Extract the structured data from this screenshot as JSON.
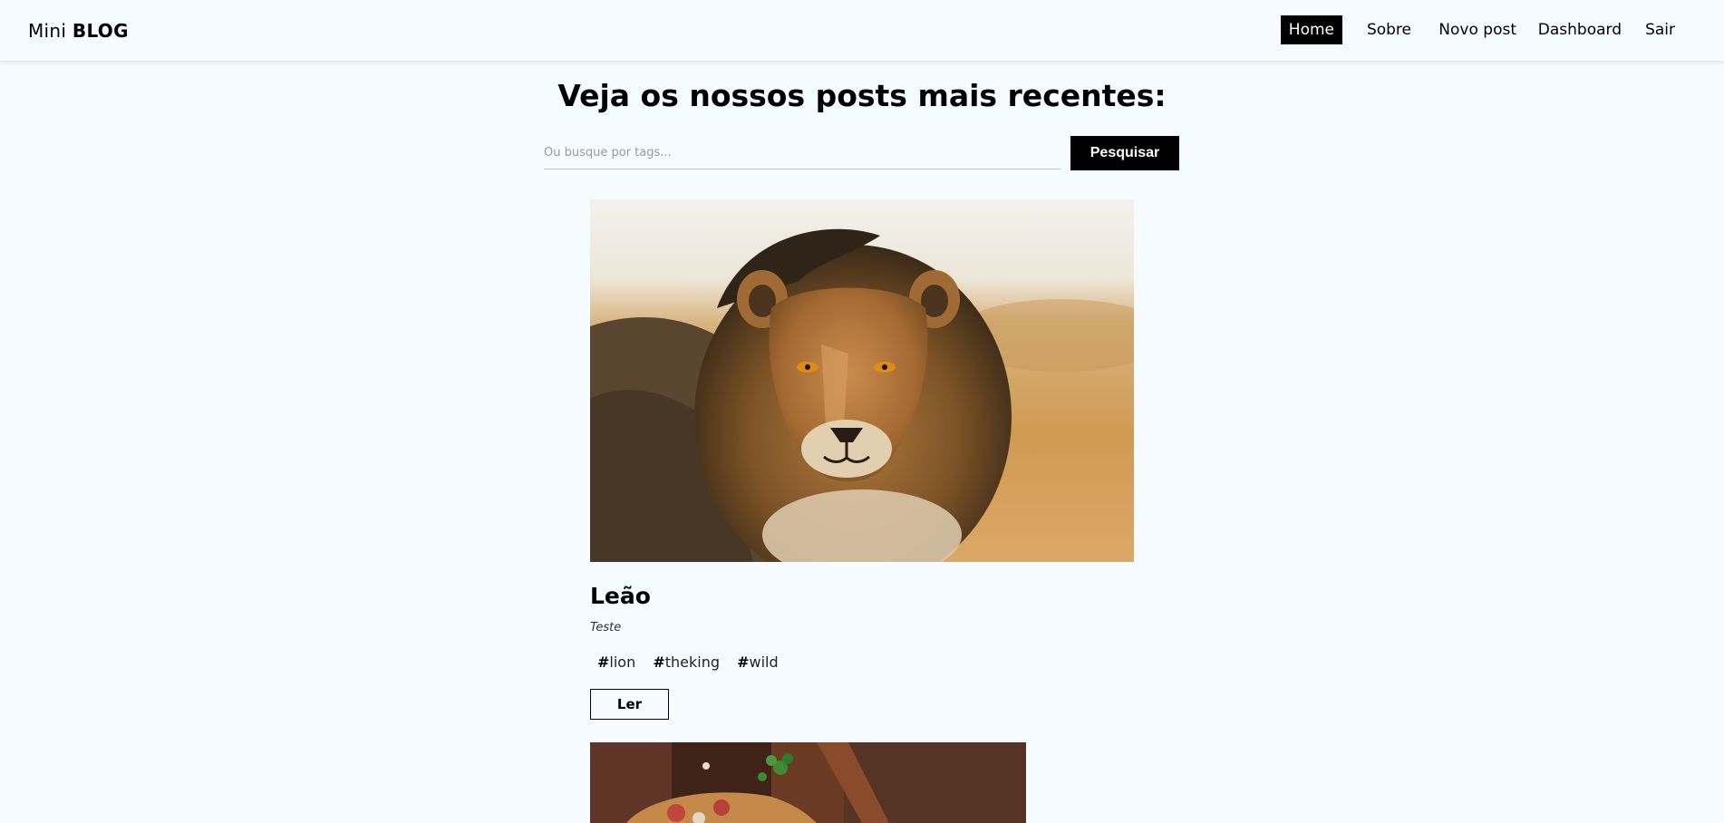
{
  "navbar": {
    "brand_light": "Mini",
    "brand_bold": "BLOG",
    "links": [
      {
        "label": "Home",
        "active": true
      },
      {
        "label": "Sobre"
      },
      {
        "label": "Novo post"
      },
      {
        "label": "Dashboard"
      },
      {
        "label": "Sair"
      }
    ]
  },
  "page": {
    "title": "Veja os nossos posts mais recentes:"
  },
  "search": {
    "placeholder": "Ou busque por tags...",
    "button_label": "Pesquisar"
  },
  "posts": [
    {
      "image": "lion-photo",
      "title": "Leão",
      "author": "Teste",
      "tags": [
        "lion",
        "theking",
        "wild"
      ],
      "read_label": "Ler"
    },
    {
      "image": "pizza-on-wooden-board-photo"
    }
  ],
  "colors": {
    "background": "#f6fbff",
    "accent": "#000000",
    "accent_text": "#ffffff"
  }
}
